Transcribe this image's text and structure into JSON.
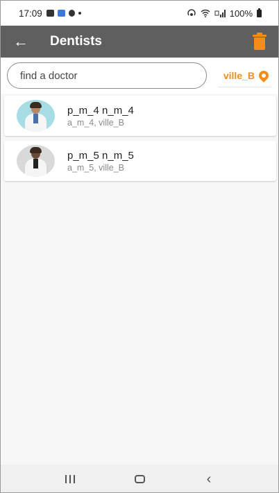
{
  "status_bar": {
    "time": "17:09",
    "battery": "100%"
  },
  "app_bar": {
    "title": "Dentists",
    "back_icon": "arrow-left-icon",
    "delete_icon": "trash-icon"
  },
  "search": {
    "placeholder": "find a doctor",
    "value": ""
  },
  "location": {
    "label": "ville_B",
    "icon": "map-pin-icon"
  },
  "doctors": [
    {
      "name": "p_m_4 n_m_4",
      "address": "a_m_4, ville_B"
    },
    {
      "name": "p_m_5 n_m_5",
      "address": "a_m_5, ville_B"
    }
  ],
  "colors": {
    "accent": "#f28c1a",
    "app_bar": "#5f5f5f"
  }
}
